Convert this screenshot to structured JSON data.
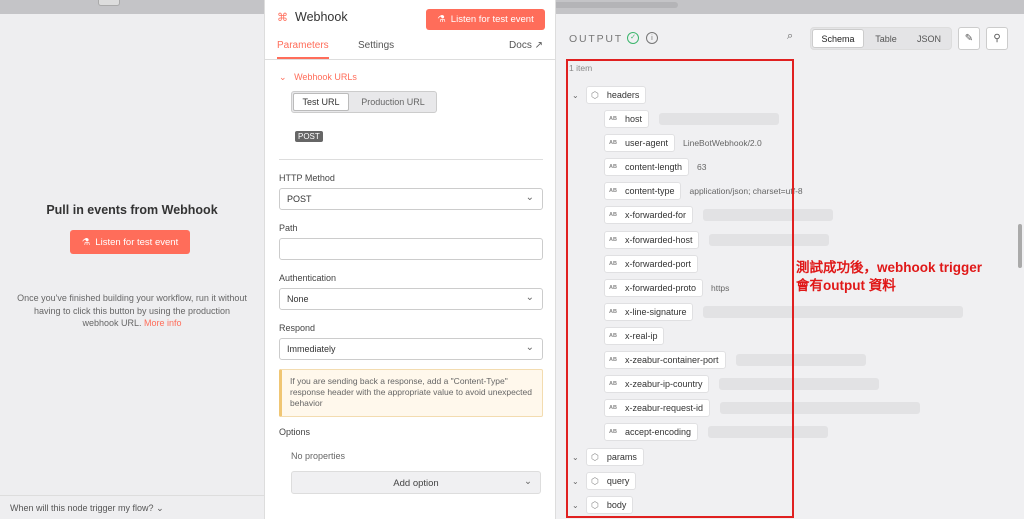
{
  "left": {
    "heading": "Pull in events from Webhook",
    "listen_button": "Listen for test event",
    "info_text": "Once you've finished building your workflow, run it without having to click this button by using the production webhook URL.",
    "info_link": "More info",
    "footer": "When will this node trigger my flow?"
  },
  "node": {
    "title": "Webhook",
    "listen_button": "Listen for test event",
    "tabs": [
      "Parameters",
      "Settings"
    ],
    "docs": "Docs",
    "section": "Webhook URLs",
    "url_tabs": [
      "Test URL",
      "Production URL"
    ],
    "method_badge": "POST",
    "http_method_label": "HTTP Method",
    "http_method_value": "POST",
    "path_label": "Path",
    "path_value": "",
    "auth_label": "Authentication",
    "auth_value": "None",
    "respond_label": "Respond",
    "respond_value": "Immediately",
    "note": "If you are sending back a response, add a \"Content-Type\" response header with the appropriate value to avoid unexpected behavior",
    "options_label": "Options",
    "no_properties": "No properties",
    "add_option": "Add option"
  },
  "output": {
    "title": "OUTPUT",
    "views": [
      "Schema",
      "Table",
      "JSON"
    ],
    "active_view": "Schema",
    "item_count": "1 item",
    "headers_label": "headers",
    "fields": [
      {
        "key": "host",
        "value": ""
      },
      {
        "key": "user-agent",
        "value": "LineBotWebhook/2.0"
      },
      {
        "key": "content-length",
        "value": "63"
      },
      {
        "key": "content-type",
        "value": "application/json; charset=utf-8"
      },
      {
        "key": "x-forwarded-for",
        "value": ""
      },
      {
        "key": "x-forwarded-host",
        "value": ""
      },
      {
        "key": "x-forwarded-port",
        "value": ""
      },
      {
        "key": "x-forwarded-proto",
        "value": "https"
      },
      {
        "key": "x-line-signature",
        "value": ""
      },
      {
        "key": "x-real-ip",
        "value": ""
      },
      {
        "key": "x-zeabur-container-port",
        "value": ""
      },
      {
        "key": "x-zeabur-ip-country",
        "value": ""
      },
      {
        "key": "x-zeabur-request-id",
        "value": ""
      },
      {
        "key": "accept-encoding",
        "value": ""
      }
    ],
    "objects": [
      "params",
      "query",
      "body"
    ]
  },
  "annotation": {
    "line1": "測試成功後，webhook trigger",
    "line2": "會有output 資料"
  },
  "colors": {
    "accent": "#ff6d5a",
    "annotation": "#e02020",
    "success": "#3bb56c"
  }
}
